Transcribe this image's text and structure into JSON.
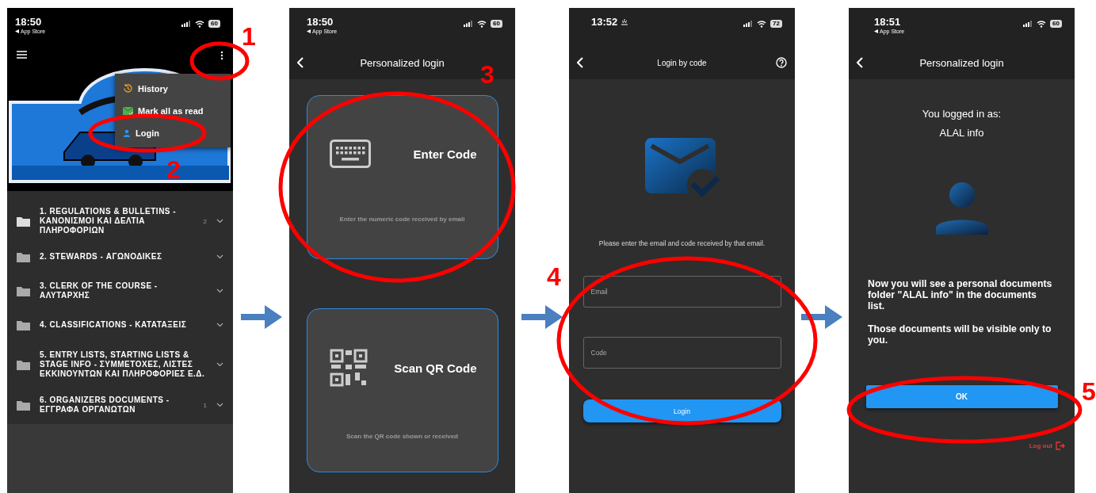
{
  "annotations": [
    "1",
    "2",
    "3",
    "4",
    "5"
  ],
  "screens": [
    {
      "kind": "documents",
      "status": {
        "time": "18:50",
        "back_label": "App Store",
        "battery": "60"
      },
      "menu_items": [
        {
          "label": "History"
        },
        {
          "label": "Mark all as read"
        },
        {
          "label": "Login"
        }
      ],
      "folders": [
        {
          "title": "1. REGULATIONS & BULLETINS - ΚΑΝΟΝΙΣΜΟΙ ΚΑΙ ΔΕΛΤΙΑ ΠΛΗΡΟΦΟΡΙΩΝ",
          "count": "2"
        },
        {
          "title": "2. STEWARDS - ΑΓΩΝΟΔΙΚΕΣ"
        },
        {
          "title": "3. CLERK OF THE COURSE - ΑΛΥΤΑΡΧΗΣ"
        },
        {
          "title": "4. CLASSIFICATIONS - ΚΑΤΑΤΑΞΕΙΣ"
        },
        {
          "title": "5. ENTRY LISTS, STARTING LISTS & STAGE INFO - ΣΥΜΜΕΤΟΧΕΣ, ΛΙΣΤΕΣ ΕΚΚΙΝΟΥΝΤΩΝ ΚΑΙ ΠΛΗΡΟΦΟΡΙΕΣ Ε.Δ."
        },
        {
          "title": "6. ORGANIZERS DOCUMENTS - ΕΓΓΡΑΦΑ ΟΡΓΑΝΩΤΩΝ",
          "count": "1"
        }
      ]
    },
    {
      "kind": "login_options",
      "status": {
        "time": "18:50",
        "back_label": "App Store",
        "battery": "60"
      },
      "title": "Personalized login",
      "options": [
        {
          "title": "Enter Code",
          "description": "Enter the numeric code received by email"
        },
        {
          "title": "Scan QR Code",
          "description": "Scan the QR code shown or received"
        }
      ]
    },
    {
      "kind": "code_login",
      "status": {
        "time": "13:52",
        "battery": "72"
      },
      "title": "Login by code",
      "prompt": "Please enter the email and code received by that email.",
      "fields": [
        {
          "placeholder": "Email"
        },
        {
          "placeholder": "Code"
        }
      ],
      "button": "Login"
    },
    {
      "kind": "logged_in",
      "status": {
        "time": "18:51",
        "back_label": "App Store",
        "battery": "60"
      },
      "title": "Personalized login",
      "heading": "You logged in as:",
      "user": "ALAL info",
      "paragraphs": [
        "Now you will see a personal documents folder \"ALAL info\" in the documents list.",
        "Those documents will be visible only to you."
      ],
      "button": "OK",
      "logout": "Log out"
    }
  ]
}
